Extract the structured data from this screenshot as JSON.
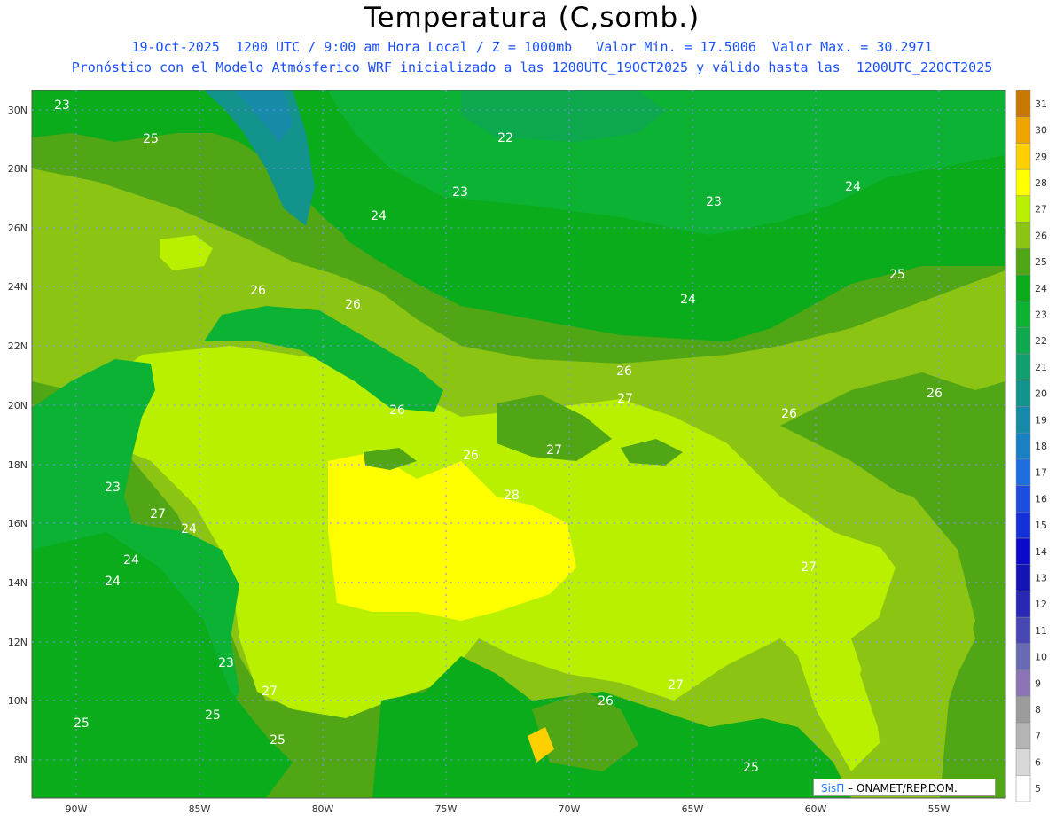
{
  "title": "Temperatura (C,somb.)",
  "subtitle_line1": "19-Oct-2025  1200 UTC / 9:00 am Hora Local / Z = 1000mb   Valor Min. = 17.5006  Valor Max. = 30.2971",
  "subtitle_line2": "Pronóstico con el Modelo Atmósferico WRF inicializado a las 1200UTC_19OCT2025 y válido hasta las  1200UTC_22OCT2025",
  "credit": {
    "brand": "SisΠ",
    "text": "– ONAMET/REP.DOM."
  },
  "latitude_labels": [
    "30N",
    "28N",
    "26N",
    "24N",
    "22N",
    "20N",
    "18N",
    "16N",
    "14N",
    "12N",
    "10N",
    "8N"
  ],
  "longitude_labels": [
    "90W",
    "85W",
    "80W",
    "75W",
    "70W",
    "65W",
    "60W",
    "55W"
  ],
  "colorbar": {
    "levels": [
      "5",
      "6",
      "7",
      "8",
      "9",
      "10",
      "11",
      "12",
      "13",
      "14",
      "15",
      "16",
      "17",
      "18",
      "19",
      "20",
      "21",
      "22",
      "23",
      "24",
      "25",
      "26",
      "27",
      "28",
      "29",
      "30",
      "31"
    ],
    "colors": [
      "#ffffff",
      "#d8d8d8",
      "#b4b4b4",
      "#9c9c9c",
      "#8c74b4",
      "#6a6ab4",
      "#4848b4",
      "#2828b4",
      "#1414b4",
      "#0a0ac8",
      "#1430d8",
      "#1c4ce0",
      "#1e6ee0",
      "#1a80c4",
      "#168aa8",
      "#12948c",
      "#109e6e",
      "#0ea84e",
      "#0cb234",
      "#0aac1c",
      "#50a614",
      "#8cc414",
      "#b8f000",
      "#ffff00",
      "#ffd000",
      "#f0a400",
      "#c87800"
    ]
  },
  "contour_labels": [
    {
      "text": "23"
    },
    {
      "text": "25"
    },
    {
      "text": "22"
    },
    {
      "text": "23"
    },
    {
      "text": "23"
    },
    {
      "text": "24"
    },
    {
      "text": "24"
    },
    {
      "text": "25"
    },
    {
      "text": "26"
    },
    {
      "text": "26"
    },
    {
      "text": "24"
    },
    {
      "text": "26"
    },
    {
      "text": "27"
    },
    {
      "text": "26"
    },
    {
      "text": "26"
    },
    {
      "text": "26"
    },
    {
      "text": "28"
    },
    {
      "text": "27"
    },
    {
      "text": "23"
    },
    {
      "text": "27"
    },
    {
      "text": "24"
    },
    {
      "text": "24"
    },
    {
      "text": "24"
    },
    {
      "text": "23"
    },
    {
      "text": "27"
    },
    {
      "text": "25"
    },
    {
      "text": "25"
    },
    {
      "text": "25"
    },
    {
      "text": "27"
    },
    {
      "text": "26"
    },
    {
      "text": "27"
    },
    {
      "text": "25"
    },
    {
      "text": "26"
    }
  ]
}
